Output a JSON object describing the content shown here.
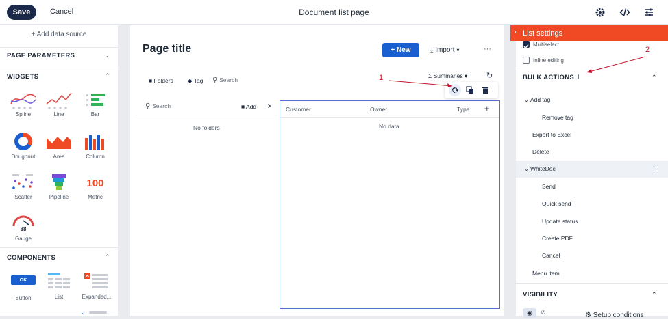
{
  "topbar": {
    "save": "Save",
    "cancel": "Cancel",
    "page_name": "Document list page",
    "icons": [
      "settings-gear-icon",
      "code-icon",
      "sliders-icon"
    ]
  },
  "left": {
    "add_data_source": "+ Add data source",
    "page_parameters": "PAGE PARAMETERS",
    "widgets_header": "WIDGETS",
    "widgets": [
      {
        "label": "Spline",
        "icon": "spline-chart-icon"
      },
      {
        "label": "Line",
        "icon": "line-chart-icon"
      },
      {
        "label": "Bar",
        "icon": "bar-chart-icon"
      },
      {
        "label": "Doughnut",
        "icon": "doughnut-chart-icon"
      },
      {
        "label": "Area",
        "icon": "area-chart-icon"
      },
      {
        "label": "Column",
        "icon": "column-chart-icon"
      },
      {
        "label": "Scatter",
        "icon": "scatter-chart-icon"
      },
      {
        "label": "Pipeline",
        "icon": "pipeline-icon"
      },
      {
        "label": "Metric",
        "icon": "metric-icon"
      },
      {
        "label": "Gauge",
        "icon": "gauge-icon"
      }
    ],
    "metric_value": "100",
    "gauge_value": "88",
    "components_header": "COMPONENTS",
    "components": [
      {
        "label": "Button",
        "preview": "OK"
      },
      {
        "label": "List"
      },
      {
        "label": "Expanded..."
      }
    ]
  },
  "canvas": {
    "title": "Page title",
    "new_button": "+ New",
    "import": "Import",
    "more": "···",
    "folders": "Folders",
    "tag": "Tag",
    "search": "Search",
    "summaries": "Summaries",
    "folder_search": "Search",
    "add": "Add",
    "no_folders": "No folders",
    "columns": [
      "Customer",
      "Owner",
      "Type"
    ],
    "no_data": "No data",
    "annotation_1": "1"
  },
  "right": {
    "list_settings": "List settings",
    "multiselect": "Multiselect",
    "inline_editing": "Inline editing",
    "bulk_actions": "BULK ACTIONS",
    "annotation_2": "2",
    "add_tag": "Add tag",
    "remove_tag": "Remove tag",
    "export_excel": "Export to Excel",
    "delete": "Delete",
    "whitedoc": "WhiteDoc",
    "send": "Send",
    "quick_send": "Quick send",
    "update_status": "Update status",
    "create_pdf": "Create PDF",
    "cancel": "Cancel",
    "menu_item": "Menu item",
    "visibility": "VISIBILITY",
    "setup_conditions": "Setup conditions",
    "accent": "#ef4a23",
    "primary": "#1a5fd0"
  }
}
